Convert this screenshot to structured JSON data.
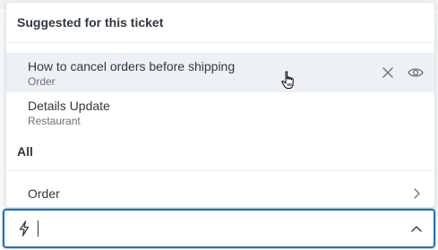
{
  "menu": {
    "suggested_header": "Suggested for this ticket",
    "suggested_items": [
      {
        "title": "How to cancel orders before shipping",
        "subtitle": "Order"
      },
      {
        "title": "Details Update",
        "subtitle": "Restaurant"
      }
    ],
    "all_header": "All",
    "all_items": [
      {
        "title": "Order"
      }
    ]
  },
  "input": {
    "value": "",
    "placeholder": ""
  },
  "icons": {
    "lightning": "lightning-icon",
    "remove": "close-icon",
    "preview": "eye-icon",
    "expand_item": "chevron-right-icon",
    "collapse": "chevron-up-icon",
    "cursor": "hand-pointer-cursor"
  },
  "colors": {
    "focus_border": "#1f73b7",
    "hover_row": "#edf1f5",
    "text_primary": "#2f3941",
    "text_secondary": "#68737d"
  }
}
